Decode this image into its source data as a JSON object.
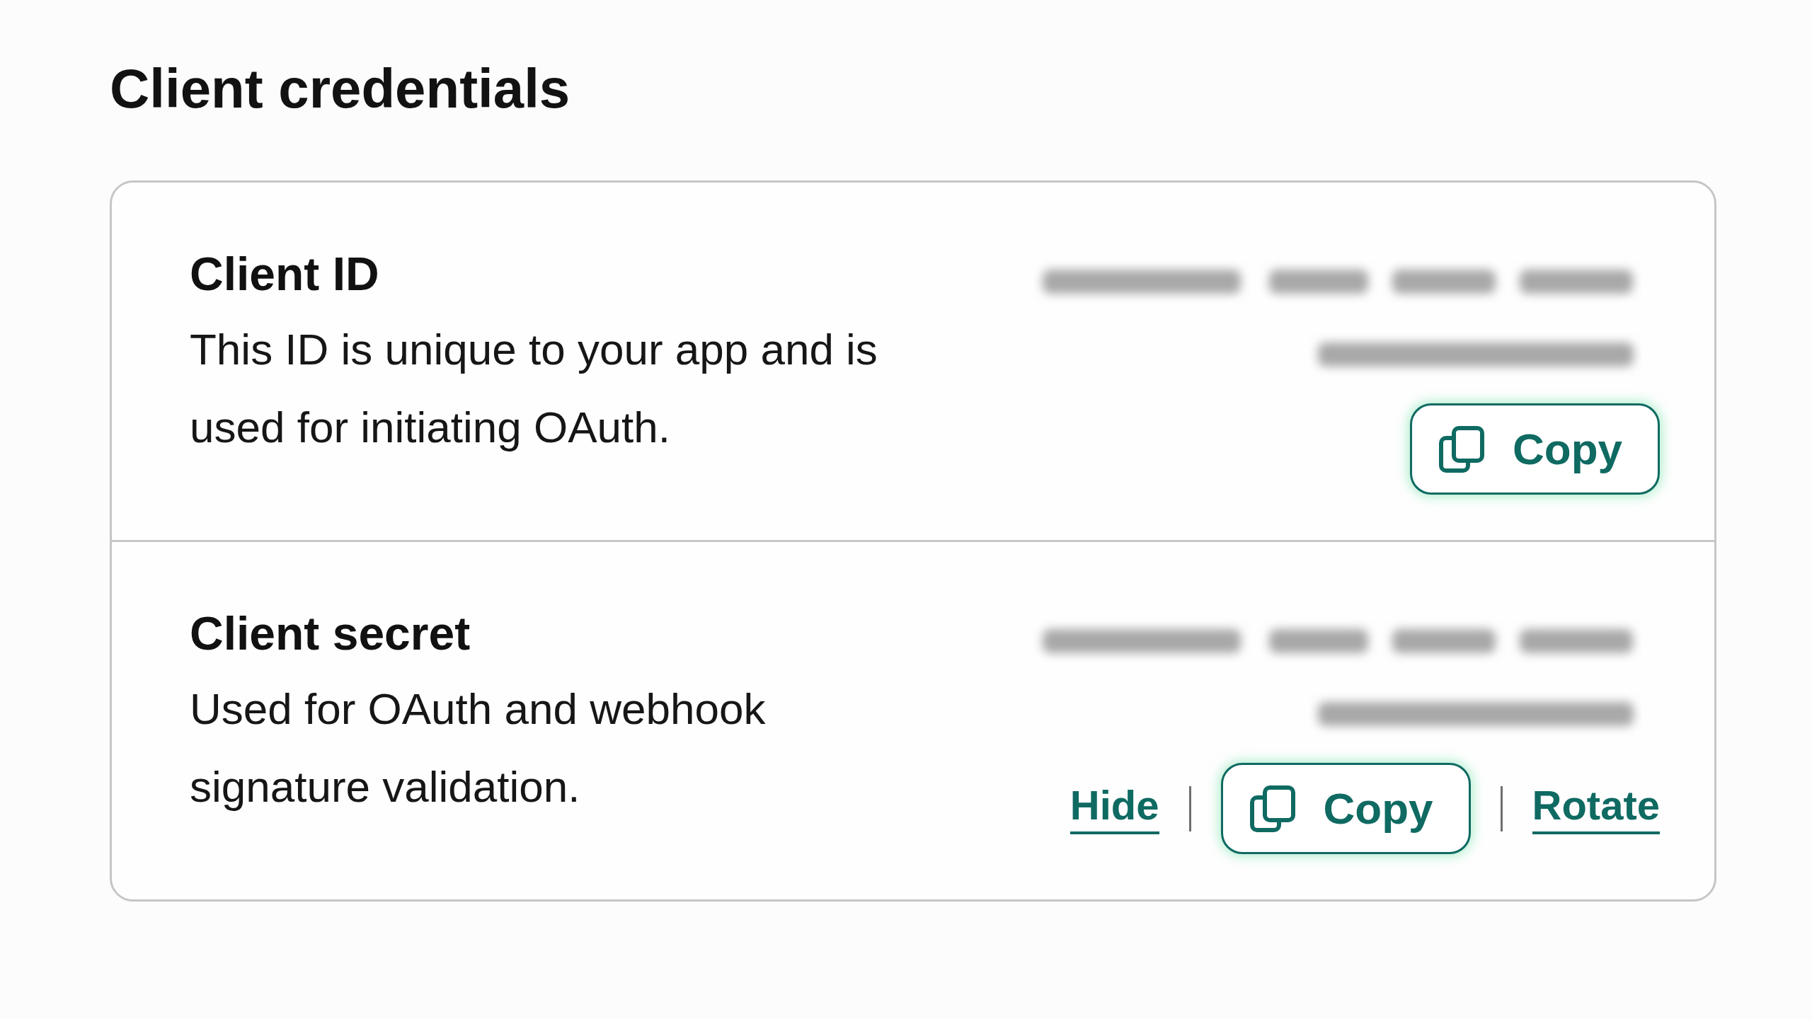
{
  "title": "Client credentials",
  "credentials": [
    {
      "label": "Client ID",
      "description": "This ID is unique to your app and is used for initiating OAuth.",
      "actions": [
        {
          "kind": "button",
          "label": "Copy"
        }
      ]
    },
    {
      "label": "Client secret",
      "description": "Used for OAuth and webhook signature validation.",
      "actions": [
        {
          "kind": "link",
          "label": "Hide"
        },
        {
          "kind": "button",
          "label": "Copy"
        },
        {
          "kind": "link",
          "label": "Rotate"
        }
      ]
    }
  ]
}
